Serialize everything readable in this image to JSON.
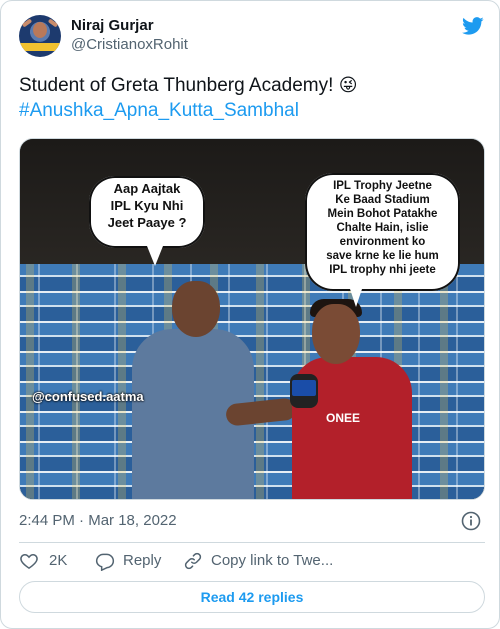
{
  "author": {
    "display_name": "Niraj Gurjar",
    "handle": "@CristianoxRohit"
  },
  "tweet": {
    "text": "Student of Greta Thunberg Academy!",
    "emoji": "😜",
    "hashtag": "#Anushka_Apna_Kutta_Sambhal"
  },
  "media": {
    "bubble_left": [
      "Aap Aajtak",
      "IPL Kyu Nhi",
      "Jeet Paaye ?"
    ],
    "bubble_right": [
      "IPL Trophy Jeetne",
      "Ke Baad Stadium",
      "Mein Bohot Patakhe",
      "Chalte Hain, islie",
      "environment ko",
      "save krne ke lie hum",
      "IPL trophy nhi jeete"
    ],
    "watermark": "@confused.aatma",
    "jersey_text": "ONEE"
  },
  "meta": {
    "time": "2:44 PM",
    "separator": " · ",
    "date": "Mar 18, 2022"
  },
  "actions": {
    "like_count": "2K",
    "reply_label": "Reply",
    "copy_label": "Copy link to Twe..."
  },
  "footer": {
    "read_replies": "Read 42 replies"
  },
  "colors": {
    "accent": "#1d9bf0",
    "muted": "#536471",
    "border": "#cfd9de"
  },
  "icons": [
    "twitter-bird-icon",
    "info-icon",
    "heart-icon",
    "reply-icon",
    "link-icon"
  ]
}
